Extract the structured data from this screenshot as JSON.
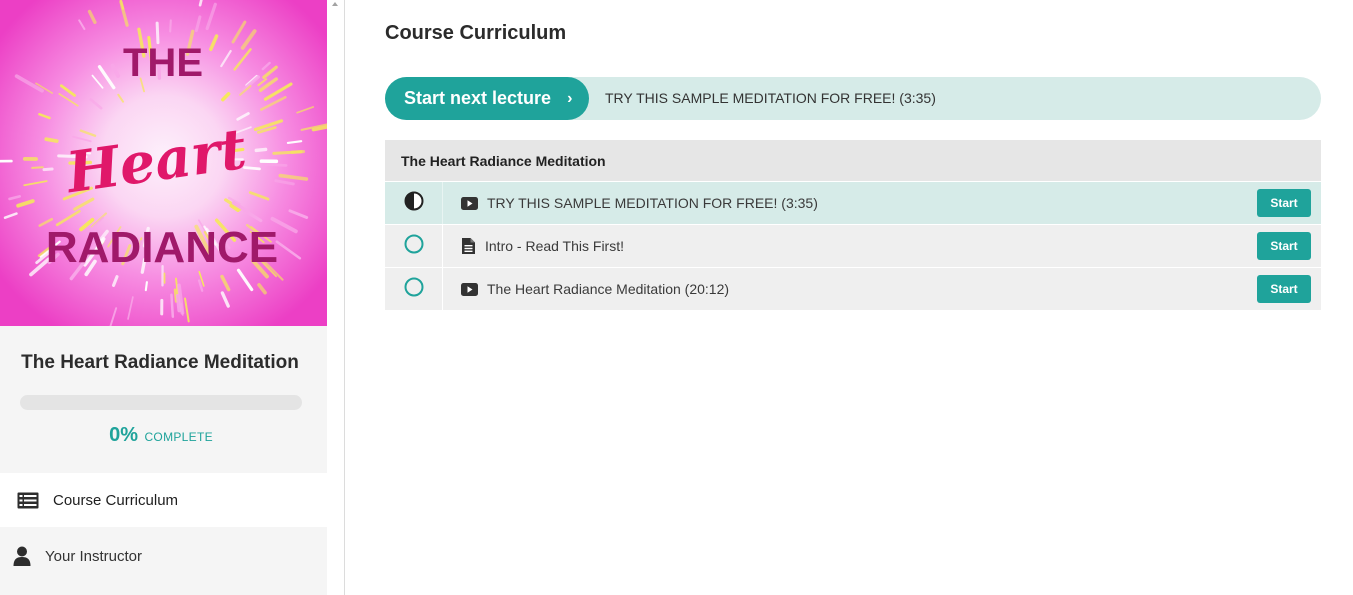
{
  "sidebar": {
    "cover": {
      "alt_lines": [
        "THE",
        "Heart",
        "RADIANCE"
      ],
      "colors": {
        "pink": "#f15fd0",
        "center": "#fdf0fb",
        "ray": "#f6e85c",
        "title": "#a0196a",
        "script": "#e0186a"
      }
    },
    "course_title": "The Heart Radiance Meditation",
    "progress": {
      "value": 0,
      "percent_label": "0%",
      "complete_label": "COMPLETE"
    },
    "nav": [
      {
        "label": "Course Curriculum",
        "icon": "list-icon",
        "active": true
      },
      {
        "label": "Your Instructor",
        "icon": "user-icon",
        "active": false
      }
    ]
  },
  "main": {
    "title": "Course Curriculum",
    "next_lecture": {
      "button_label": "Start next lecture",
      "chevron": "›",
      "lecture_title": "TRY THIS SAMPLE MEDITATION FOR FREE! (3:35)"
    },
    "sections": [
      {
        "title": "The Heart Radiance Meditation",
        "lectures": [
          {
            "title": "TRY THIS SAMPLE MEDITATION FOR FREE! (3:35)",
            "type": "video-icon",
            "status": "in-progress",
            "button": "Start"
          },
          {
            "title": "Intro - Read This First!",
            "type": "document-icon",
            "status": "not-started",
            "button": "Start"
          },
          {
            "title": "The Heart Radiance Meditation (20:12)",
            "type": "video-icon",
            "status": "not-started",
            "button": "Start"
          }
        ]
      }
    ]
  },
  "colors": {
    "accent": "#1fa39b",
    "highlight": "#d6ebe8"
  }
}
